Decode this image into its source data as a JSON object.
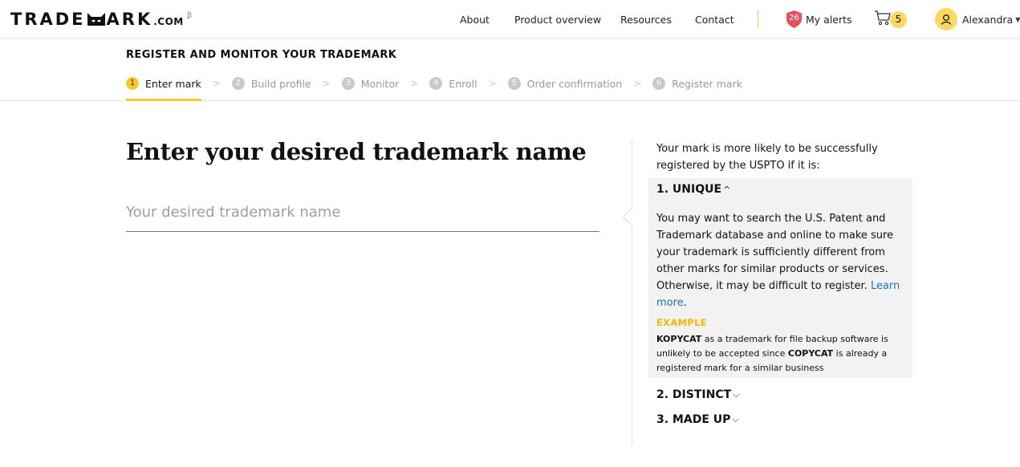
{
  "header": {
    "logo": {
      "prefix": "TRADE",
      "suffix": "ARK",
      "domain": ".COM",
      "beta": "β"
    },
    "nav": [
      "About",
      "Product overview",
      "Resources",
      "Contact"
    ],
    "alerts": {
      "count": "26",
      "label": "My alerts"
    },
    "cart": {
      "count": "5"
    },
    "user": {
      "name": "Alexandra"
    }
  },
  "subheader": {
    "title": "REGISTER AND MONITOR YOUR TRADEMARK",
    "steps": [
      {
        "num": "1",
        "label": "Enter mark",
        "active": true
      },
      {
        "num": "2",
        "label": "Build profile",
        "active": false
      },
      {
        "num": "3",
        "label": "Monitor",
        "active": false
      },
      {
        "num": "4",
        "label": "Enroll",
        "active": false
      },
      {
        "num": "5",
        "label": "Order confirmation",
        "active": false
      },
      {
        "num": "6",
        "label": "Register mark",
        "active": false
      }
    ]
  },
  "main": {
    "title": "Enter your desired trademark name",
    "input": {
      "value": "",
      "placeholder": "Your desired trademark name"
    }
  },
  "sidebar": {
    "intro": "Your mark is more likely to be successfully registered by the USPTO if it is:",
    "sections": [
      {
        "label": "1. UNIQUE",
        "expanded": true
      },
      {
        "label": "2. DISTINCT",
        "expanded": false
      },
      {
        "label": "3. MADE UP",
        "expanded": false
      }
    ],
    "unique_body": "You may want to search the U.S. Patent and Trademark database and online to make sure your trademark is sufficiently different from other marks for similar products or services. Otherwise, it may be difficult to register.",
    "learn_more": "Learn more",
    "example_label": "EXAMPLE",
    "example": {
      "term1": "KOPYCAT",
      "text1": " as a trademark for file backup software is unlikely to be accepted since ",
      "term2": "COPYCAT",
      "text2": " is already a registered mark for a similar business"
    }
  },
  "colors": {
    "accent": "#f6c92f",
    "link": "#1a73b8",
    "alert": "#e5505e",
    "panel": "#f2f2f2"
  }
}
